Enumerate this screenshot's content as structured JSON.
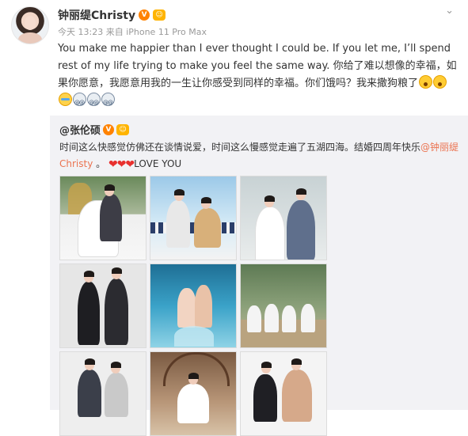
{
  "post": {
    "author": "钟丽缇Christy",
    "verified_badge": "V",
    "meta": "今天 13:23 来自 iPhone 11 Pro Max",
    "text_en": "You make me happier than I ever thought I could be. If you let me, I’ll spend rest of my life trying to make you feel the same way.",
    "text_cn": "你给了难以想像的幸福，如果你愿意，我愿意用我的一生让你感受到同样的幸福。你们饿吗？我来撒狗粮了",
    "emoji": [
      "shock-face",
      "shock-face",
      "tear-face",
      "dizzy-face",
      "dizzy-face",
      "dizzy-face"
    ]
  },
  "repost": {
    "author": "@张伦硕",
    "verified_badge": "V",
    "text_before": "时间这么快感觉仿佛还在谈情说爱，时间这么慢感觉走遍了五湖四海。结婚四周年快乐",
    "mention": "@钟丽缇Christy",
    "text_after": " 。",
    "hearts": "❤❤❤",
    "love_text": "LOVE YOU",
    "images": [
      {
        "scene": "wedding-garden"
      },
      {
        "scene": "casual-couch"
      },
      {
        "scene": "wedding-suit"
      },
      {
        "scene": "studio-black"
      },
      {
        "scene": "underwater"
      },
      {
        "scene": "group-garden"
      },
      {
        "scene": "studio-pose"
      },
      {
        "scene": "wedding-arch"
      },
      {
        "scene": "fitness"
      }
    ]
  },
  "colors": {
    "accent": "#eb7350",
    "verified": "#ff8200",
    "heart": "#e8302e",
    "repost_bg": "#f2f2f5"
  },
  "icons": {
    "more": "chevron-down-icon"
  }
}
